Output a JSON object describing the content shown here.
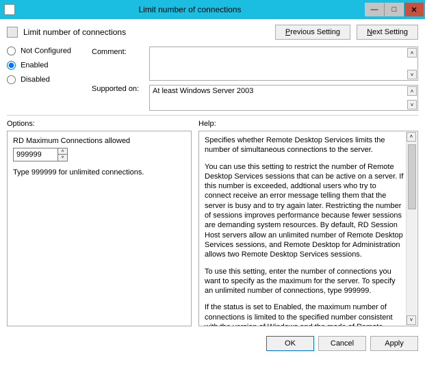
{
  "titlebar": {
    "title": "Limit number of connections"
  },
  "header": {
    "title": "Limit number of connections",
    "prev_p": "P",
    "prev_rest": "revious Setting",
    "next_n": "N",
    "next_rest": "ext Setting"
  },
  "radios": {
    "not_configured": "Not Configured",
    "enabled": "Enabled",
    "disabled": "Disabled"
  },
  "labels": {
    "comment": "Comment:",
    "supported": "Supported on:",
    "options": "Options:",
    "help": "Help:"
  },
  "supported": {
    "value": "At least Windows Server 2003"
  },
  "options": {
    "rd_label": "RD Maximum Connections allowed",
    "rd_value": "999999",
    "hint": "Type 999999 for unlimited connections."
  },
  "help": {
    "p1": "Specifies whether Remote Desktop Services limits the number of simultaneous connections to the server.",
    "p2": "You can use this setting to restrict the number of Remote Desktop Services sessions that can be active on a server. If this number is exceeded, addtional users who try to connect receive an error message telling them that the server is busy and to try again later. Restricting the number of sessions improves performance because fewer sessions are demanding system resources. By default, RD Session Host servers allow an unlimited number of Remote Desktop Services sessions, and Remote Desktop for Administration allows two Remote Desktop Services sessions.",
    "p3": "To use this setting, enter the number of connections you want to specify as the maximum for the server. To specify an unlimited number of connections, type 999999.",
    "p4": "If the status is set to Enabled, the maximum number of connections is limited to the specified number consistent with the version of Windows and the mode of Remote Desktop"
  },
  "footer": {
    "ok": "OK",
    "cancel": "Cancel",
    "apply": "Apply"
  }
}
